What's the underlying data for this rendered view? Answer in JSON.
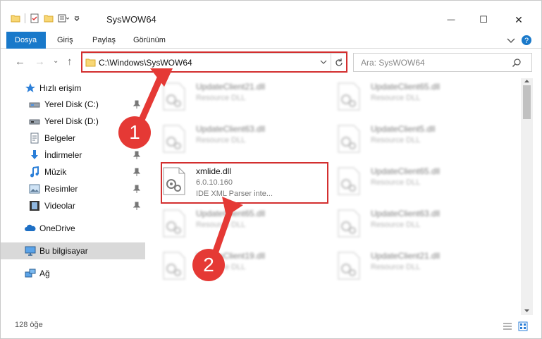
{
  "window": {
    "title": "SysWOW64",
    "minimize_glyph": "—",
    "maximize_glyph": "☐",
    "close_glyph": "✕"
  },
  "ribbon": {
    "tabs": [
      {
        "label": "Dosya",
        "active": true
      },
      {
        "label": "Giriş"
      },
      {
        "label": "Paylaş"
      },
      {
        "label": "Görünüm"
      }
    ]
  },
  "address": {
    "path": "C:\\Windows\\SysWOW64",
    "search_placeholder": "Ara: SysWOW64"
  },
  "sidebar": {
    "items": [
      {
        "label": "Hızlı erişim",
        "icon": "star-icon"
      },
      {
        "label": "Yerel Disk (C:)",
        "icon": "drive-icon",
        "pinned": true
      },
      {
        "label": "Yerel Disk (D:)",
        "icon": "drive-icon",
        "pinned": true
      },
      {
        "label": "Belgeler",
        "icon": "document-icon",
        "pinned": true
      },
      {
        "label": "İndirmeler",
        "icon": "download-icon",
        "pinned": true
      },
      {
        "label": "Müzik",
        "icon": "music-icon",
        "pinned": true
      },
      {
        "label": "Resimler",
        "icon": "picture-icon",
        "pinned": true
      },
      {
        "label": "Videolar",
        "icon": "video-icon",
        "pinned": true
      },
      {
        "label": "OneDrive",
        "icon": "cloud-icon"
      },
      {
        "label": "Bu bilgisayar",
        "icon": "computer-icon",
        "selected": true
      },
      {
        "label": "Ağ",
        "icon": "network-icon"
      }
    ]
  },
  "files": [
    {
      "name": "UpdateClient21.dll",
      "sub": "Resource DLL",
      "blurred": true
    },
    {
      "name": "UpdateClient65.dll",
      "sub": "Resource DLL",
      "blurred": true
    },
    {
      "name": "UpdateClient63.dll",
      "sub": "Resource DLL",
      "blurred": true
    },
    {
      "name": "UpdateClient5.dll",
      "sub": "Resource DLL",
      "blurred": true
    },
    {
      "name": "xmlide.dll",
      "sub": "6.0.10.160",
      "sub2": "IDE XML Parser inte...",
      "blurred": false
    },
    {
      "name": "UpdateClient65.dll",
      "sub": "Resource DLL",
      "blurred": true
    },
    {
      "name": "UpdateClient65.dll",
      "sub": "Resource DLL",
      "blurred": true
    },
    {
      "name": "UpdateClient63.dll",
      "sub": "Resource DLL",
      "blurred": true
    },
    {
      "name": "UpdateClient19.dll",
      "sub": "Resource DLL",
      "blurred": true
    },
    {
      "name": "UpdateClient21.dll",
      "sub": "Resource DLL",
      "blurred": true
    }
  ],
  "status": {
    "count": "128 öğe"
  },
  "annotations": {
    "badge1": "1",
    "badge2": "2",
    "highlight_color": "#d32f2f"
  },
  "colors": {
    "accent": "#1979ca",
    "annotation": "#e53935"
  }
}
